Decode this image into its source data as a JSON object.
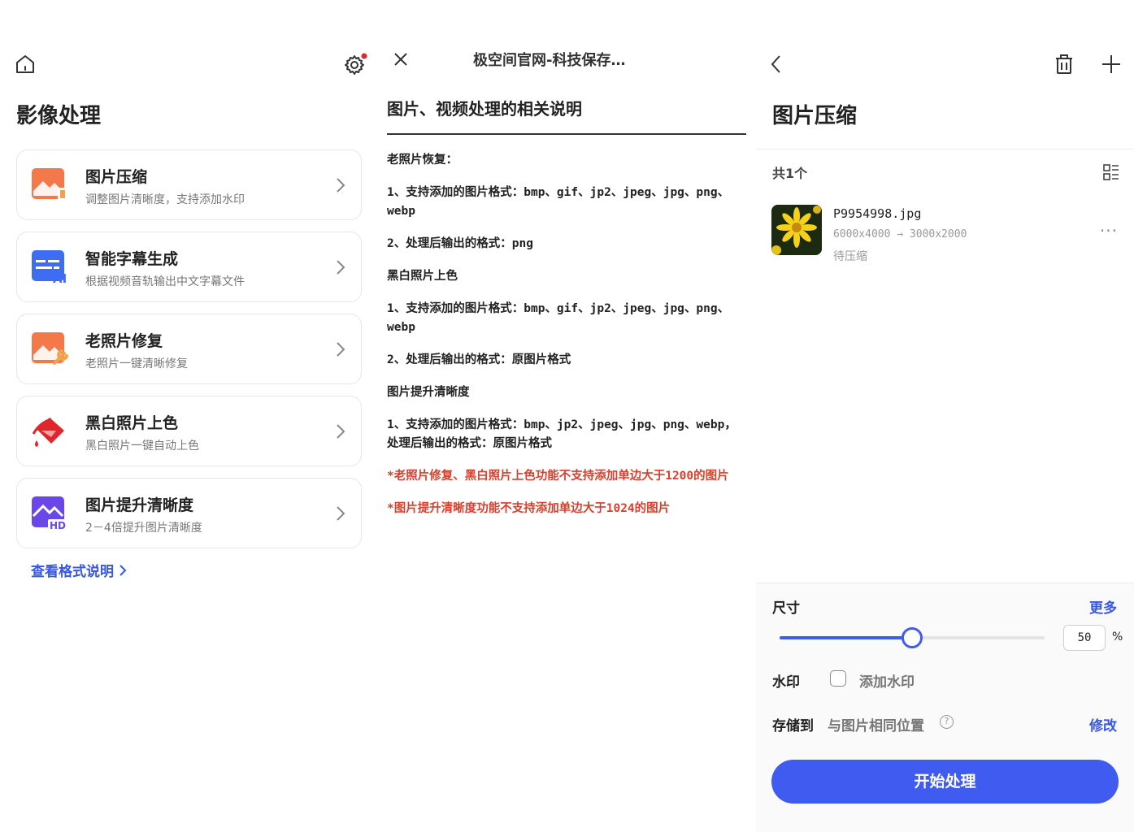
{
  "screen1": {
    "title": "影像处理",
    "cards": [
      {
        "title": "图片压缩",
        "subtitle": "调整图片清晰度，支持添加水印",
        "icon": "image-compress-icon"
      },
      {
        "title": "智能字幕生成",
        "subtitle": "根据视频音轨输出中文字幕文件",
        "icon": "ai-subtitle-icon"
      },
      {
        "title": "老照片修复",
        "subtitle": "老照片一键清晰修复",
        "icon": "photo-repair-icon"
      },
      {
        "title": "黑白照片上色",
        "subtitle": "黑白照片一键自动上色",
        "icon": "paint-bucket-icon"
      },
      {
        "title": "图片提升清晰度",
        "subtitle": "2－4倍提升图片清晰度",
        "icon": "hd-image-icon"
      }
    ],
    "format_link": "查看格式说明"
  },
  "screen2": {
    "header_title": "极空间官网-科技保存…",
    "heading": "图片、视频处理的相关说明",
    "paragraphs": [
      {
        "text": "老照片恢复：",
        "red": false
      },
      {
        "text": "1、支持添加的图片格式：bmp、gif、jp2、jpeg、jpg、png、webp",
        "red": false
      },
      {
        "text": "2、处理后输出的格式：png",
        "red": false
      },
      {
        "text": "黑白照片上色",
        "red": false
      },
      {
        "text": "1、支持添加的图片格式：bmp、gif、jp2、jpeg、jpg、png、webp",
        "red": false
      },
      {
        "text": "2、处理后输出的格式：原图片格式",
        "red": false
      },
      {
        "text": "图片提升清晰度",
        "red": false
      },
      {
        "text": "1、支持添加的图片格式：bmp、jp2、jpeg、jpg、png、webp，处理后输出的格式：原图片格式",
        "red": false
      },
      {
        "text": "*老照片修复、黑白照片上色功能不支持添加单边大于1200的图片",
        "red": true
      },
      {
        "text": "*图片提升清晰度功能不支持添加单边大于1024的图片",
        "red": true
      }
    ]
  },
  "screen3": {
    "title": "图片压缩",
    "count": "共1个",
    "file": {
      "name": "P9954998.jpg",
      "size": "6000x4000 → 3000x2000",
      "status": "待压缩"
    },
    "size_label": "尺寸",
    "more_label": "更多",
    "scale_percent": "50",
    "scale_value": 0.5,
    "percent_unit": "%",
    "watermark_label": "水印",
    "watermark_option": "添加水印",
    "save_label": "存储到",
    "save_location": "与图片相同位置",
    "modify_label": "修改",
    "start_button": "开始处理"
  },
  "colors": {
    "accent": "#3f5bf0",
    "link": "#3756e6",
    "warning_text": "#d6402f",
    "notification_dot": "#e0262d"
  }
}
